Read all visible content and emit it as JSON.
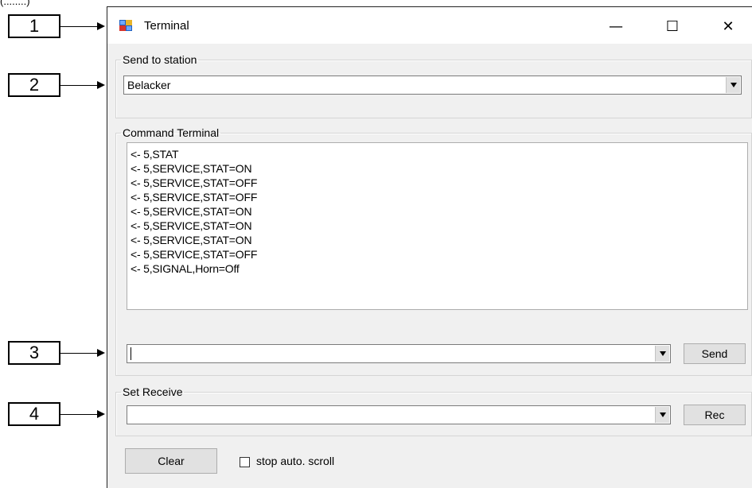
{
  "callouts": [
    {
      "number": "1"
    },
    {
      "number": "2"
    },
    {
      "number": "3"
    },
    {
      "number": "4"
    }
  ],
  "top_fragment": "(........)",
  "window": {
    "title": "Terminal",
    "icon": "app-window-icon",
    "minimize_icon": "minimize-icon",
    "maximize_icon": "maximize-icon",
    "close_icon": "close-icon",
    "minimize_glyph": "—",
    "maximize_glyph": "☐",
    "close_glyph": "✕"
  },
  "send_to_station": {
    "legend": "Send to station",
    "selected": "Belacker"
  },
  "command_terminal": {
    "legend": "Command Terminal",
    "lines": [
      "<- 5,STAT",
      "<- 5,SERVICE,STAT=ON",
      "<- 5,SERVICE,STAT=OFF",
      "<- 5,SERVICE,STAT=OFF",
      "<- 5,SERVICE,STAT=ON",
      "<- 5,SERVICE,STAT=ON",
      "<- 5,SERVICE,STAT=ON",
      "<- 5,SERVICE,STAT=OFF",
      "<- 5,SIGNAL,Horn=Off"
    ],
    "input_value": "",
    "send_label": "Send"
  },
  "set_receive": {
    "legend": "Set Receive",
    "value": "",
    "rec_label": "Rec"
  },
  "bottom": {
    "clear_label": "Clear",
    "stop_scroll_label": "stop auto. scroll",
    "stop_scroll_checked": false
  }
}
